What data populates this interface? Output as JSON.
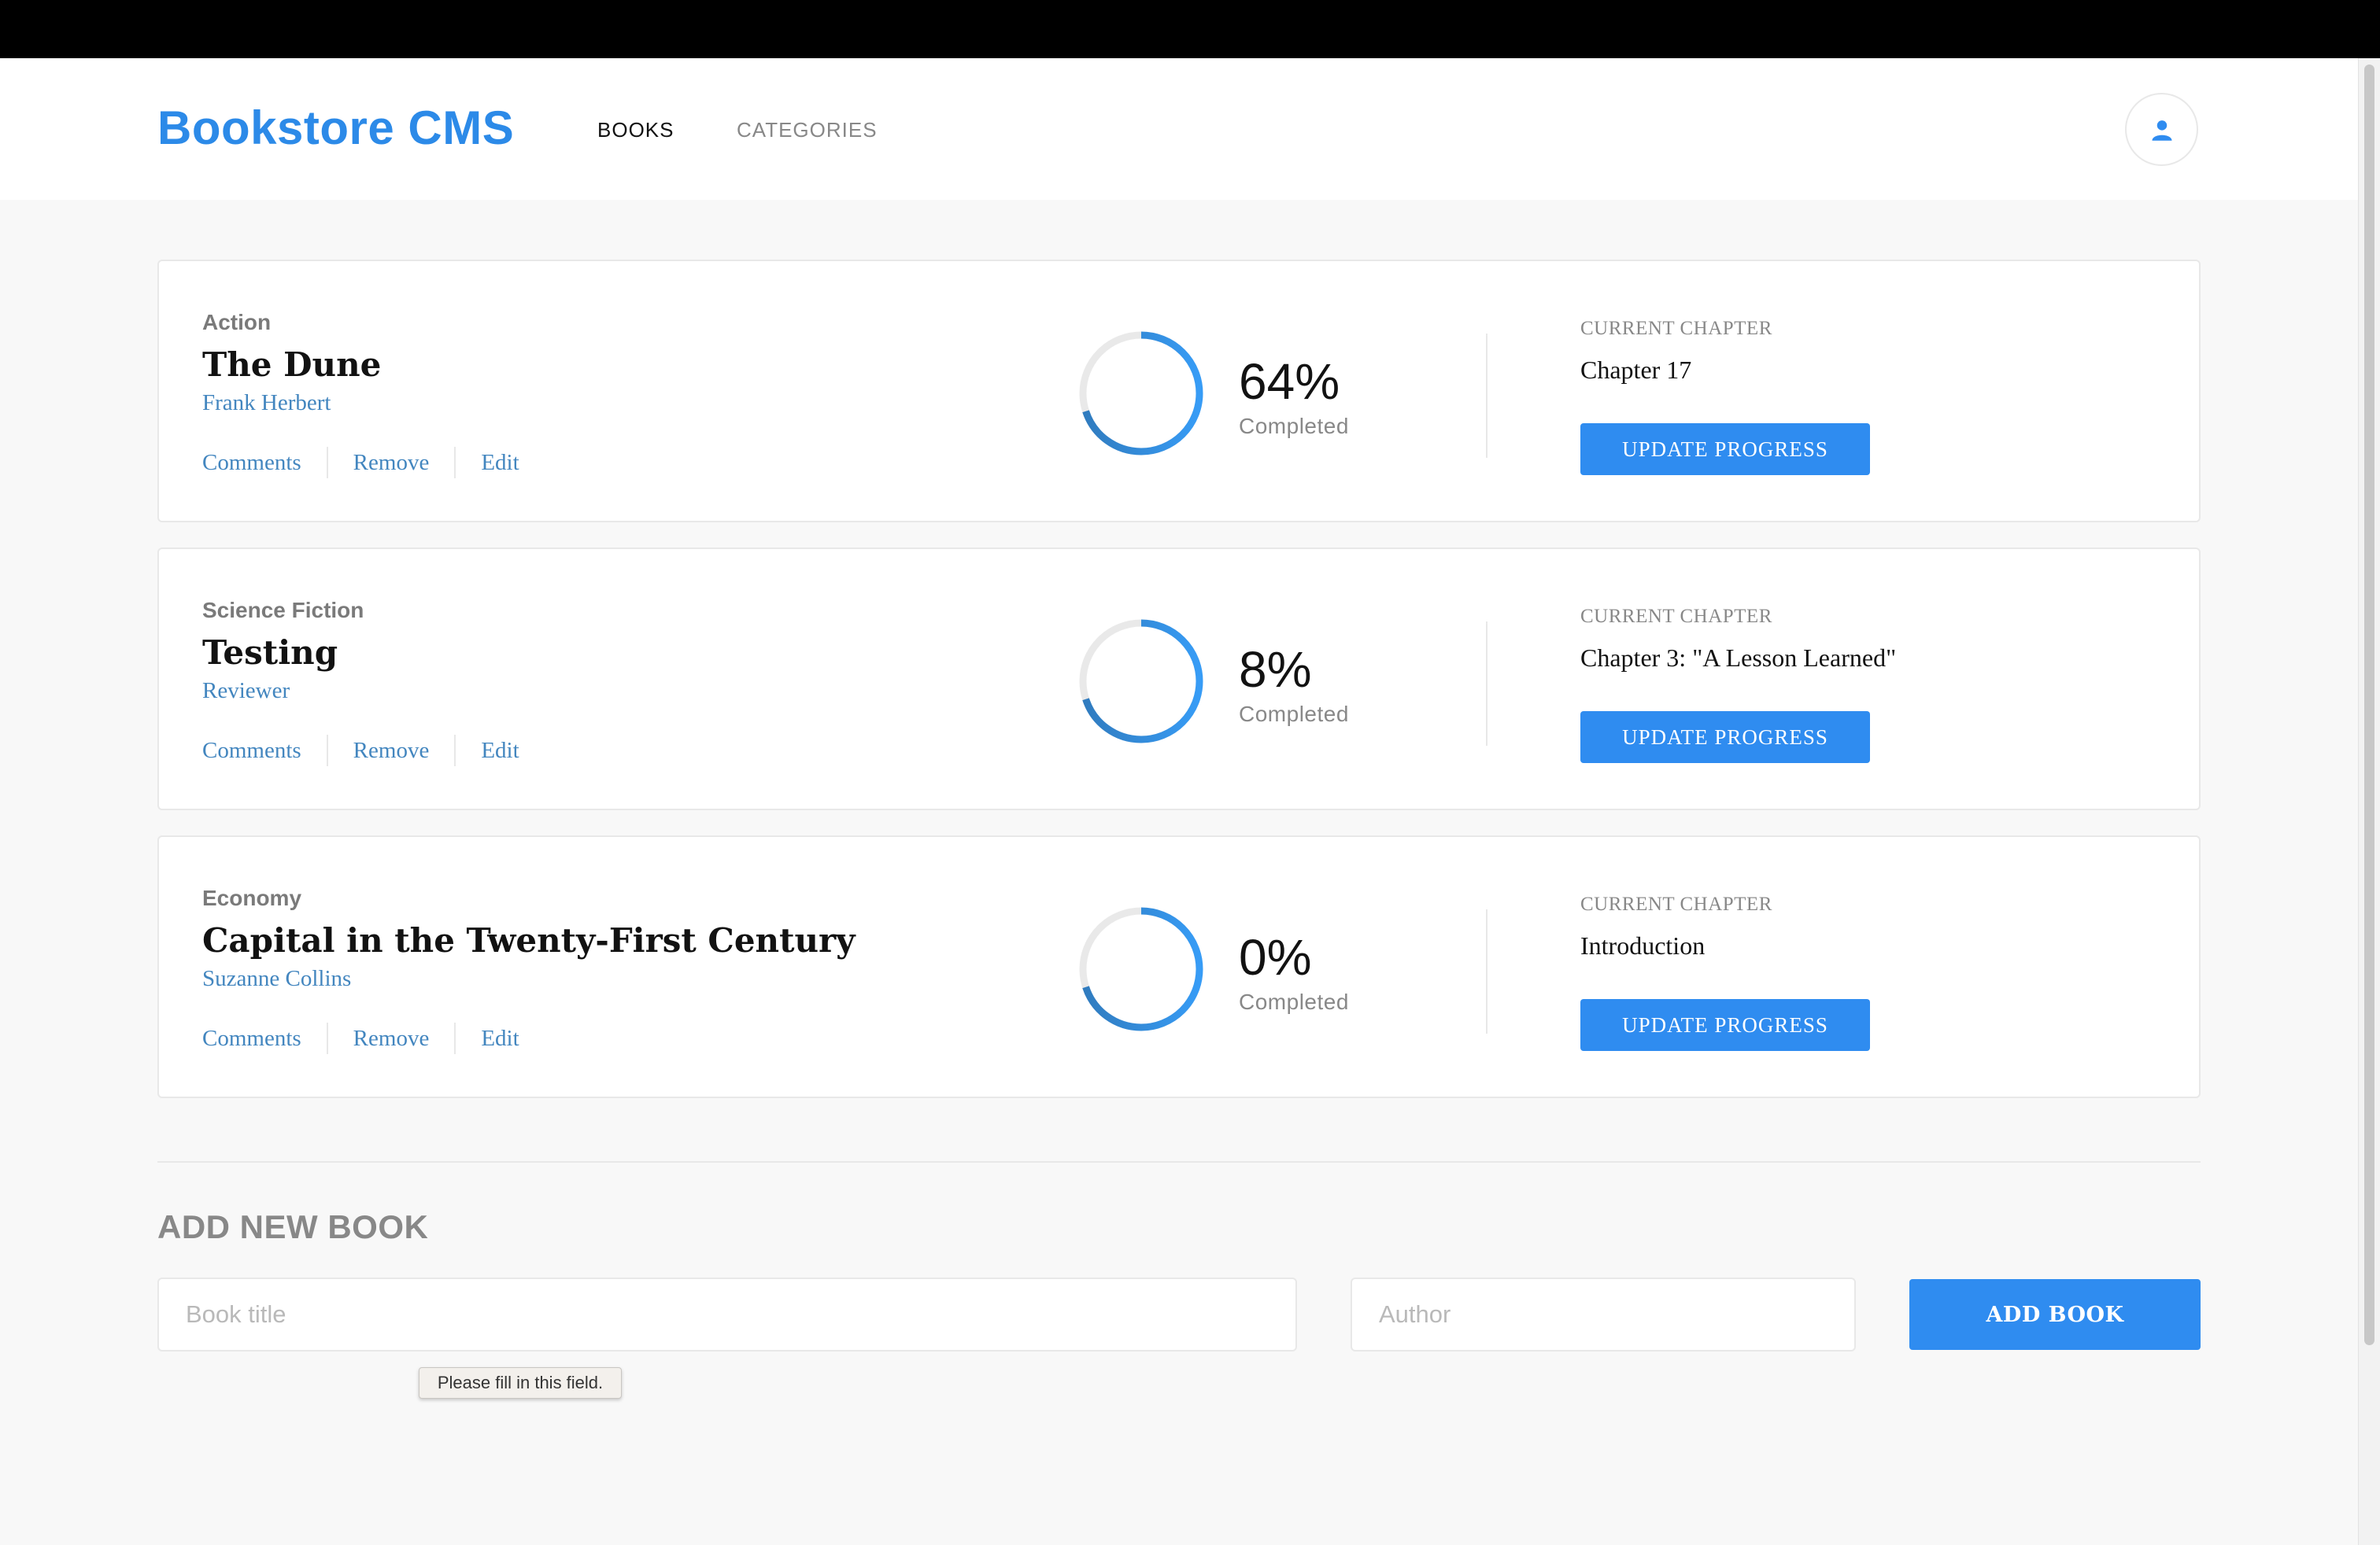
{
  "app": {
    "logo": "Bookstore CMS",
    "nav": {
      "books": "BOOKS",
      "categories": "CATEGORIES"
    },
    "user_icon": "user-icon",
    "accent_color": "#2f8cf0"
  },
  "books": [
    {
      "genre": "Action",
      "title": "The Dune",
      "author": "Frank Herbert",
      "actions": [
        "Comments",
        "Remove",
        "Edit"
      ],
      "progress_percent": 64,
      "progress_label": "64%",
      "completed_label": "Completed",
      "current_chapter_label": "CURRENT CHAPTER",
      "current_chapter": "Chapter 17",
      "update_button": "UPDATE PROGRESS"
    },
    {
      "genre": "Science Fiction",
      "title": "Testing",
      "author": "Reviewer",
      "actions": [
        "Comments",
        "Remove",
        "Edit"
      ],
      "progress_percent": 8,
      "progress_label": "8%",
      "completed_label": "Completed",
      "current_chapter_label": "CURRENT CHAPTER",
      "current_chapter": "Chapter 3: \"A Lesson Learned\"",
      "update_button": "UPDATE PROGRESS"
    },
    {
      "genre": "Economy",
      "title": "Capital in the Twenty-First Century",
      "author": "Suzanne Collins",
      "actions": [
        "Comments",
        "Remove",
        "Edit"
      ],
      "progress_percent": 0,
      "progress_label": "0%",
      "completed_label": "Completed",
      "current_chapter_label": "CURRENT CHAPTER",
      "current_chapter": "Introduction",
      "update_button": "UPDATE PROGRESS"
    }
  ],
  "add_form": {
    "heading": "ADD NEW BOOK",
    "title_placeholder": "Book title",
    "author_placeholder": "Author",
    "submit_label": "ADD BOOK",
    "validation_tooltip": "Please fill in this field."
  }
}
